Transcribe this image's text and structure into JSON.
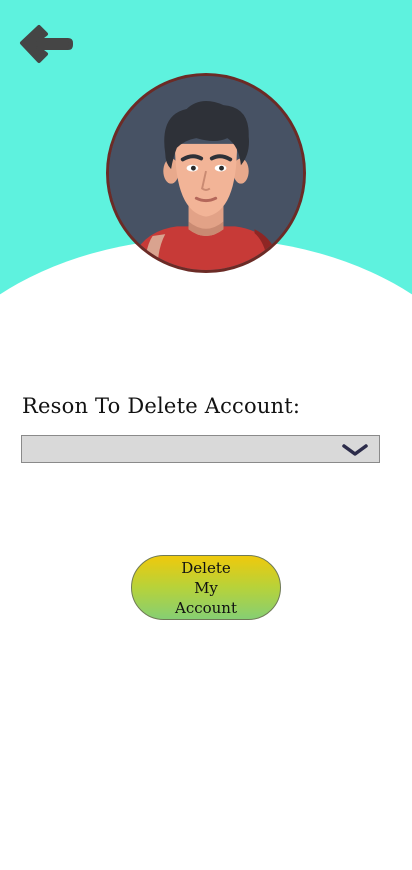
{
  "header": {
    "back_icon": "arrow-left-icon",
    "accent_color": "#5ef2de"
  },
  "profile": {
    "avatar_icon": "user-avatar"
  },
  "form": {
    "reason_label": "Reson To Delete Account:",
    "reason_select": {
      "selected_value": "",
      "icon": "chevron-down-icon"
    },
    "delete_button_label": "Delete My Account",
    "button_gradient": [
      "#efc90c",
      "#86cf73"
    ]
  }
}
